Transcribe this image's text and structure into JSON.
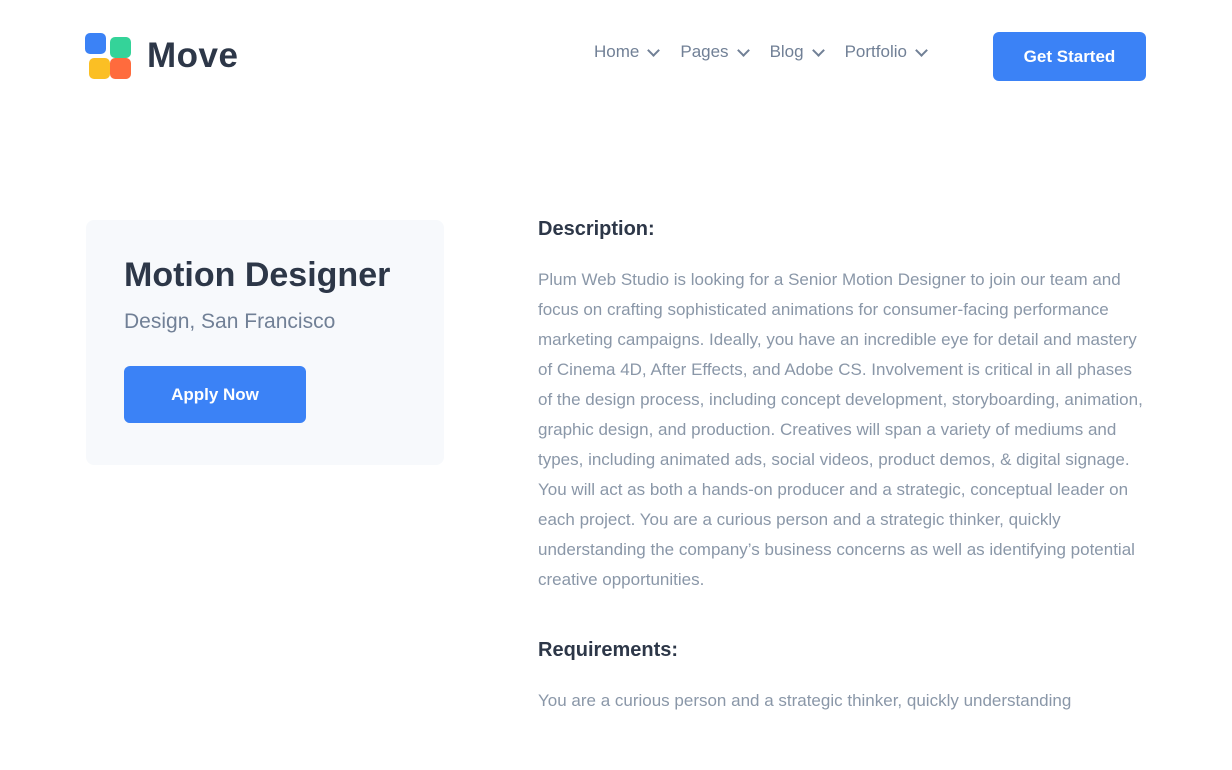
{
  "brand": {
    "name": "Move",
    "logo_colors": [
      "#3b82f6",
      "#34d399",
      "#fbbf24",
      "#ff6b3d"
    ]
  },
  "nav": {
    "items": [
      {
        "label": "Home"
      },
      {
        "label": "Pages"
      },
      {
        "label": "Blog"
      },
      {
        "label": "Portfolio"
      }
    ],
    "cta_label": "Get Started"
  },
  "job": {
    "title": "Motion Designer",
    "subtitle": "Design, San Francisco",
    "apply_label": "Apply Now"
  },
  "description": {
    "heading": "Description:",
    "text": "Plum Web Studio is looking for a Senior Motion Designer to join our team and focus on crafting sophisticated animations for consumer-facing performance marketing campaigns. Ideally, you have an incredible eye for detail and mastery of Cinema 4D, After Effects, and Adobe CS. Involvement is critical in all phases of the design process, including concept development, storyboarding, animation, graphic design, and production. Creatives will span a variety of mediums and types, including animated ads, social videos, product demos, & digital signage. You will act as both a hands-on producer and a strategic, conceptual leader on each project. You are a curious person and a strategic thinker, quickly understanding the company’s business concerns as well as identifying potential creative opportunities."
  },
  "requirements": {
    "heading": "Requirements:",
    "text": "You are a curious person and a strategic thinker, quickly understanding"
  },
  "colors": {
    "accent": "#3b82f6",
    "heading": "#2d3748",
    "muted": "#8a97a8",
    "card_bg": "#f7f9fc"
  }
}
